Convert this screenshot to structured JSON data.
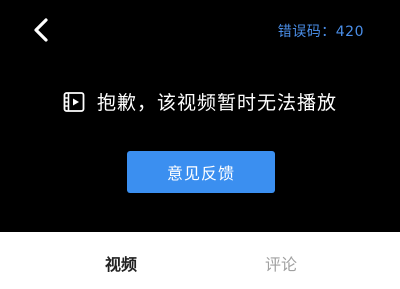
{
  "player": {
    "error_code_label": "错误码：420",
    "message": "抱歉，该视频暂时无法播放",
    "feedback_button_label": "意见反馈",
    "back_icon": "chevron-left-icon",
    "video_icon": "film-icon"
  },
  "tabs": [
    {
      "label": "视频",
      "active": true
    },
    {
      "label": "评论",
      "active": false
    }
  ],
  "colors": {
    "player_background": "#000000",
    "accent": "#3b8ff0",
    "error_code": "#4a8ee8",
    "tab_active": "#222222",
    "tab_inactive": "#a0a0a0"
  }
}
